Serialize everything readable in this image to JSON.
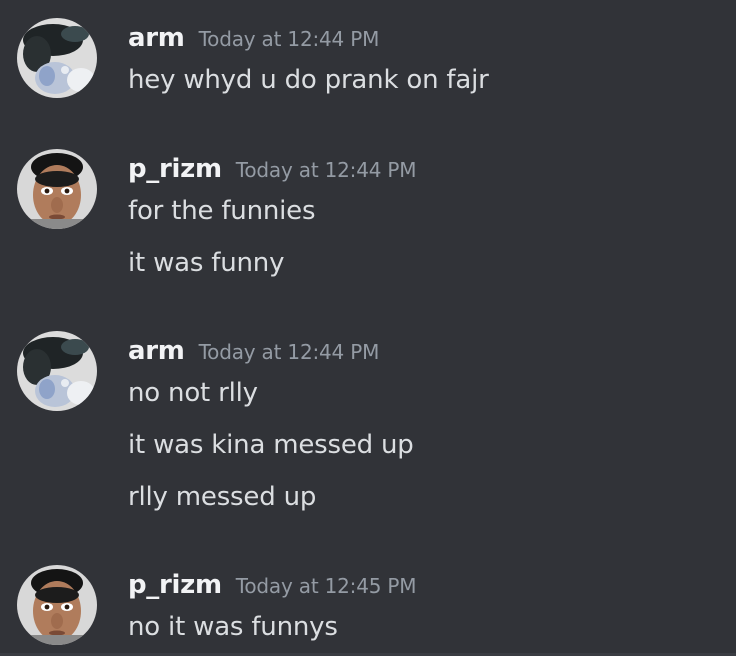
{
  "messages": [
    {
      "username": "arm",
      "timestamp": "Today at 12:44 PM",
      "avatar_icon": "arm-avatar-icon",
      "lines": [
        "hey whyd u do prank on fajr"
      ]
    },
    {
      "username": "p_rizm",
      "timestamp": "Today at 12:44 PM",
      "avatar_icon": "p-rizm-avatar-icon",
      "lines": [
        "for the funnies",
        "it was funny"
      ]
    },
    {
      "username": "arm",
      "timestamp": "Today at 12:44 PM",
      "avatar_icon": "arm-avatar-icon",
      "lines": [
        "no not rlly",
        "it was kina messed up",
        "rlly messed up"
      ]
    },
    {
      "username": "p_rizm",
      "timestamp": "Today at 12:45 PM",
      "avatar_icon": "p-rizm-avatar-icon",
      "lines": [
        "no it was funnys"
      ]
    }
  ],
  "colors": {
    "background": "#313338",
    "username": "#f2f3f5",
    "timestamp": "#949ba4",
    "message_text": "#dbdee1"
  }
}
